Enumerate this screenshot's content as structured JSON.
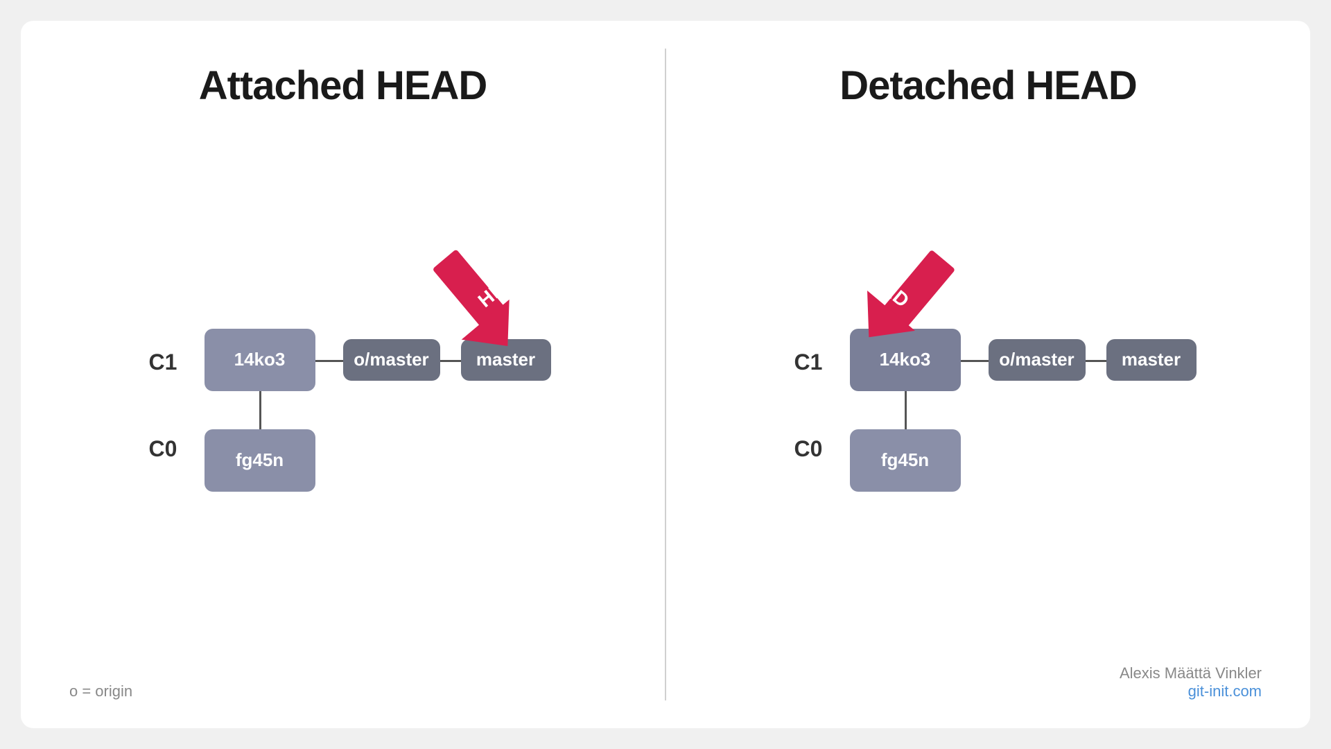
{
  "left_panel": {
    "title": "Attached HEAD",
    "c1_label": "C1",
    "c0_label": "C0",
    "node_c1": "14ko3",
    "node_omaster": "o/master",
    "node_master": "master",
    "node_c0": "fg45n",
    "head_label": "HEAD"
  },
  "right_panel": {
    "title": "Detached HEAD",
    "c1_label": "C1",
    "c0_label": "C0",
    "node_c1": "14ko3",
    "node_omaster": "o/master",
    "node_master": "master",
    "node_c0": "fg45n",
    "head_label": "HEAD"
  },
  "footer": {
    "legend": "o = origin",
    "author": "Alexis Määttä Vinkler",
    "website": "git-init.com"
  }
}
